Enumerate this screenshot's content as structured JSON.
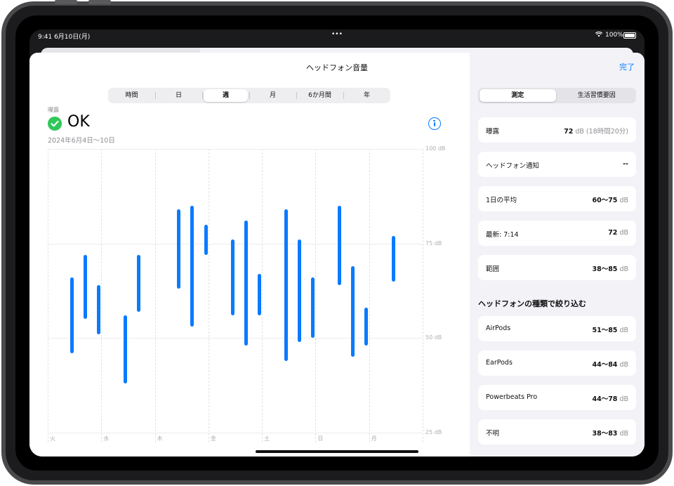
{
  "status_bar": {
    "time_date": "9:41  6月10日(月)",
    "dots": "•••",
    "battery": "100%"
  },
  "header": {
    "title": "ヘッドフォン音量",
    "done_label": "完了"
  },
  "time_ranges": [
    "時間",
    "日",
    "週",
    "月",
    "6か月間",
    "年"
  ],
  "selected_range": "週",
  "exposure": {
    "caption": "曝露",
    "status": "OK",
    "date_range": "2024年6月4日〜10日"
  },
  "right_tabs": [
    "測定",
    "生活習慣要因"
  ],
  "selected_right_tab": "測定",
  "summary_rows": [
    {
      "label": "曝露",
      "value": "72",
      "unit": "dB (18時間20分)"
    },
    {
      "label": "ヘッドフォン通知",
      "value": "--",
      "unit": ""
    },
    {
      "label": "1日の平均",
      "value": "60〜75",
      "unit": "dB"
    },
    {
      "label": "最新: 7:14",
      "value": "72",
      "unit": "dB"
    },
    {
      "label": "範囲",
      "value": "38〜85",
      "unit": "dB"
    }
  ],
  "filter_heading": "ヘッドフォンの種類で絞り込む",
  "filter_rows": [
    {
      "label": "AirPods",
      "value": "51〜85",
      "unit": "dB"
    },
    {
      "label": "EarPods",
      "value": "44〜84",
      "unit": "dB"
    },
    {
      "label": "Powerbeats Pro",
      "value": "44〜78",
      "unit": "dB"
    },
    {
      "label": "不明",
      "value": "38〜83",
      "unit": "dB"
    }
  ],
  "colors": {
    "accent": "#0a7aff",
    "ok_green": "#30c759",
    "panel_bg": "#f2f2f7"
  },
  "chart_data": {
    "type": "bar",
    "subtype": "range",
    "y_tick_labels": [
      "100 dB",
      "75 dB",
      "50 dB",
      "25 dB"
    ],
    "y_ticks": [
      100,
      75,
      50,
      25
    ],
    "ylim": [
      25,
      100
    ],
    "x_tick_labels": [
      "火",
      "水",
      "木",
      "金",
      "土",
      "日",
      "月"
    ],
    "grid": true,
    "ranges": [
      {
        "x": 0.45,
        "low": 46,
        "high": 66
      },
      {
        "x": 0.7,
        "low": 55,
        "high": 72
      },
      {
        "x": 0.95,
        "low": 51,
        "high": 64
      },
      {
        "x": 1.45,
        "low": 38,
        "high": 56
      },
      {
        "x": 1.7,
        "low": 57,
        "high": 72
      },
      {
        "x": 2.45,
        "low": 63,
        "high": 84
      },
      {
        "x": 2.7,
        "low": 53,
        "high": 85
      },
      {
        "x": 2.95,
        "low": 72,
        "high": 80
      },
      {
        "x": 3.45,
        "low": 56,
        "high": 76
      },
      {
        "x": 3.7,
        "low": 48,
        "high": 81
      },
      {
        "x": 3.95,
        "low": 56,
        "high": 67
      },
      {
        "x": 4.45,
        "low": 44,
        "high": 84
      },
      {
        "x": 4.7,
        "low": 49,
        "high": 76
      },
      {
        "x": 4.95,
        "low": 50,
        "high": 66
      },
      {
        "x": 5.45,
        "low": 64,
        "high": 85
      },
      {
        "x": 5.7,
        "low": 45,
        "high": 69
      },
      {
        "x": 5.95,
        "low": 48,
        "high": 58
      },
      {
        "x": 6.45,
        "low": 65,
        "high": 77
      }
    ]
  }
}
